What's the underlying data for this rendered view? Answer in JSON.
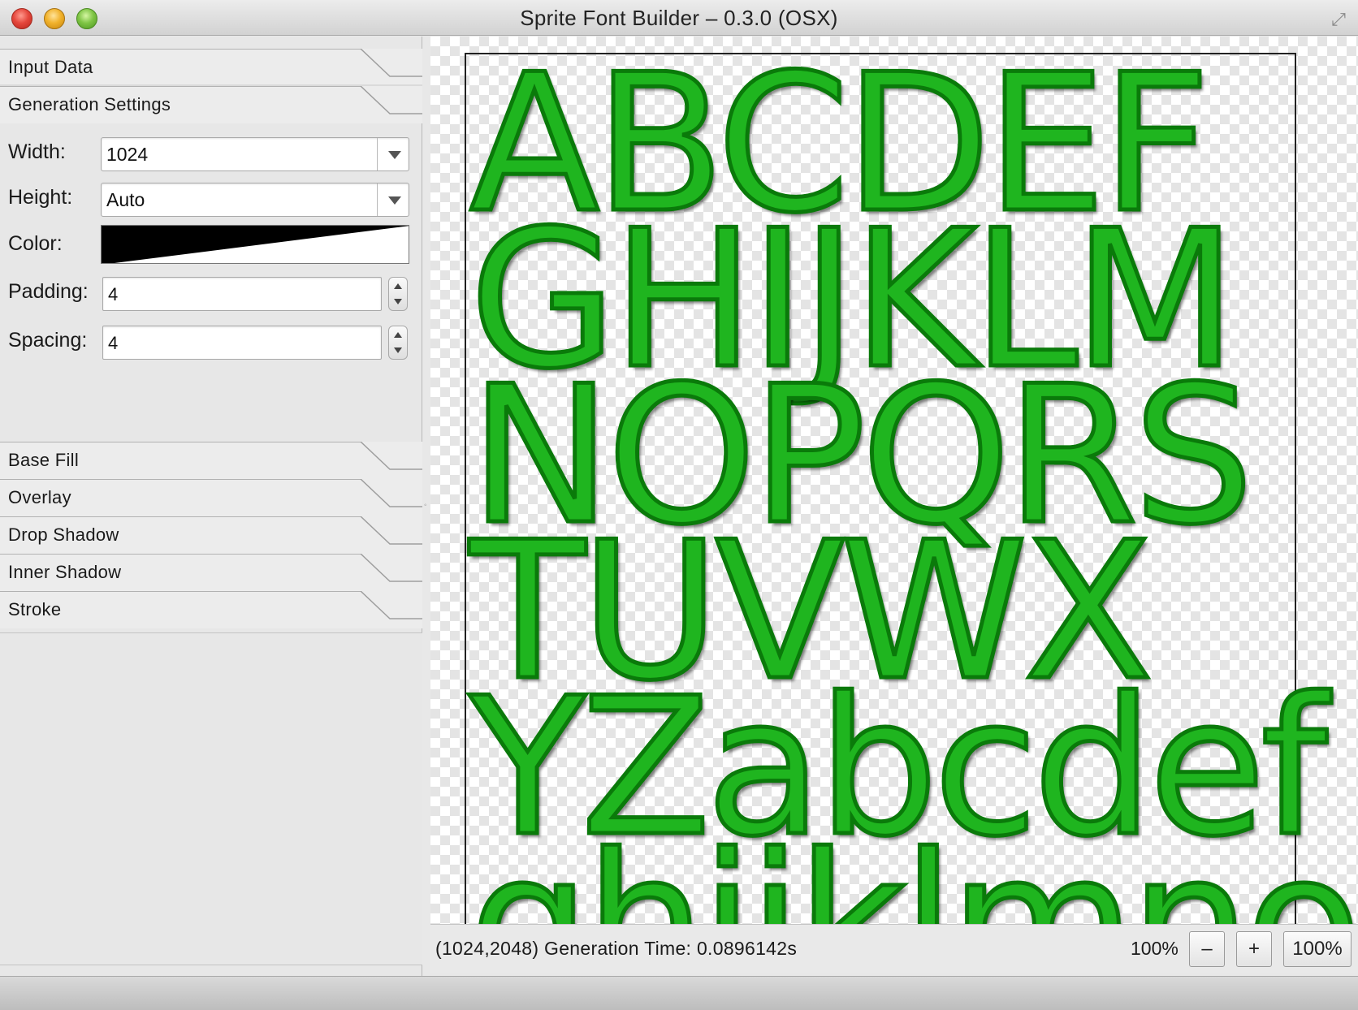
{
  "window": {
    "title": "Sprite Font Builder – 0.3.0 (OSX)",
    "controls": [
      "close",
      "minimize",
      "zoom"
    ],
    "fullscreen_icon": "fullscreen-arrows-icon"
  },
  "sidebar": {
    "sections": {
      "input_data": "Input Data",
      "generation_settings": "Generation Settings",
      "base_fill": "Base Fill",
      "overlay": "Overlay",
      "drop_shadow": "Drop Shadow",
      "inner_shadow": "Inner Shadow",
      "stroke": "Stroke"
    },
    "settings": {
      "width_label": "Width:",
      "width_value": "1024",
      "height_label": "Height:",
      "height_value": "Auto",
      "color_label": "Color:",
      "color_gradient": [
        "#000000",
        "#ffffff"
      ],
      "padding_label": "Padding:",
      "padding_value": "4",
      "spacing_label": "Spacing:",
      "spacing_value": "4"
    }
  },
  "preview": {
    "glyph_rows": [
      "ABCDEF",
      "GHIJKLM",
      "NOPQRS",
      "TUVWX",
      "YZabcdef",
      "ghijklmno"
    ],
    "glyph_color": "#1fb51f",
    "glyph_outline_color": "#0a7a0a"
  },
  "status": {
    "info": "(1024,2048) Generation Time: 0.0896142s",
    "zoom_label": "100%",
    "zoom_out_label": "–",
    "zoom_in_label": "+",
    "zoom_reset_label": "100%"
  }
}
